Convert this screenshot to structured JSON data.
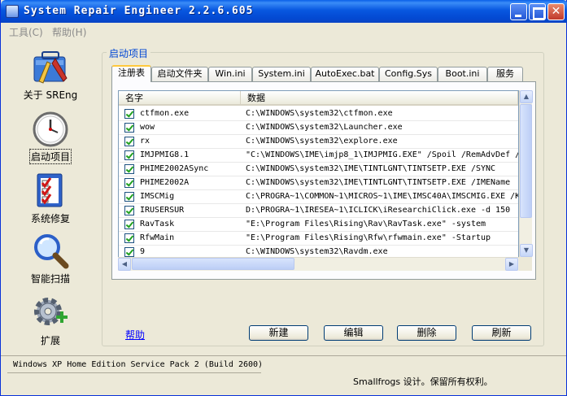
{
  "window": {
    "title": "System Repair Engineer 2.2.6.605"
  },
  "menu": {
    "tools": "工具(C)",
    "help": "帮助(H)"
  },
  "sidebar": {
    "items": [
      {
        "label": "关于 SREng",
        "icon": "about-toolbox-icon"
      },
      {
        "label": "启动项目",
        "icon": "clock-icon"
      },
      {
        "label": "系统修复",
        "icon": "checklist-icon"
      },
      {
        "label": "智能扫描",
        "icon": "magnifier-icon"
      },
      {
        "label": "扩展",
        "icon": "gear-plus-icon"
      }
    ]
  },
  "group": {
    "title": "启动项目"
  },
  "tabs": [
    "注册表",
    "启动文件夹",
    "Win.ini",
    "System.ini",
    "AutoExec.bat",
    "Config.Sys",
    "Boot.ini",
    "服务"
  ],
  "list": {
    "columns": [
      "名字",
      "数据"
    ],
    "rows": [
      {
        "name": "ctfmon.exe",
        "value": "C:\\WINDOWS\\system32\\ctfmon.exe"
      },
      {
        "name": "wow",
        "value": "C:\\WINDOWS\\system32\\Launcher.exe"
      },
      {
        "name": "rx",
        "value": "C:\\WINDOWS\\system32\\explore.exe"
      },
      {
        "name": "IMJPMIG8.1",
        "value": "\"C:\\WINDOWS\\IME\\imjp8_1\\IMJPMIG.EXE\" /Spoil /RemAdvDef /"
      },
      {
        "name": "PHIME2002ASync",
        "value": "C:\\WINDOWS\\system32\\IME\\TINTLGNT\\TINTSETP.EXE /SYNC"
      },
      {
        "name": "PHIME2002A",
        "value": "C:\\WINDOWS\\system32\\IME\\TINTLGNT\\TINTSETP.EXE /IMEName"
      },
      {
        "name": "IMSCMig",
        "value": "C:\\PROGRA~1\\COMMON~1\\MICROS~1\\IME\\IMSC40A\\IMSCMIG.EXE /K"
      },
      {
        "name": "IRUSERSUR",
        "value": "D:\\PROGRA~1\\IRESEA~1\\ICLICK\\iResearchiClick.exe -d 150"
      },
      {
        "name": "RavTask",
        "value": "\"E:\\Program Files\\Rising\\Rav\\RavTask.exe\" -system"
      },
      {
        "name": "RfwMain",
        "value": "\"E:\\Program Files\\Rising\\Rfw\\rfwmain.exe\" -Startup"
      },
      {
        "name": "9",
        "value": "C:\\WINDOWS\\system32\\Ravdm.exe"
      }
    ]
  },
  "actions": {
    "help": "帮助",
    "new": "新建",
    "edit": "编辑",
    "delete": "删除",
    "refresh": "刷新"
  },
  "status": {
    "os": "Windows XP Home Edition Service Pack 2 (Build 2600)",
    "copyright": "Smallfrogs 设计。保留所有权利。"
  }
}
